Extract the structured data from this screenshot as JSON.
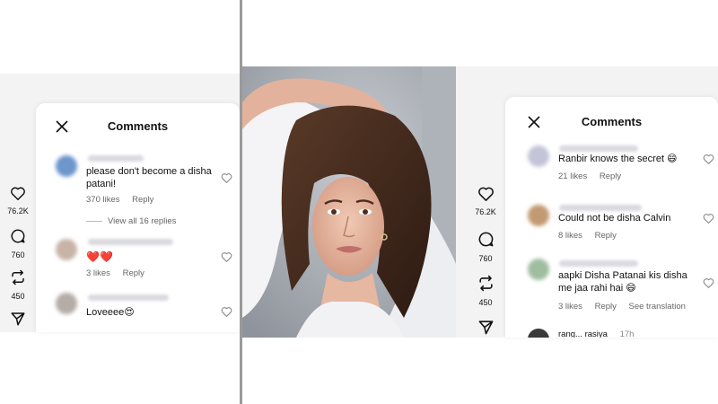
{
  "left": {
    "title": "Comments",
    "rail": {
      "likes": "76.2K",
      "comments": "760",
      "reposts": "450"
    },
    "comments": [
      {
        "text": "please don't become a disha patani!",
        "likes": "370 likes",
        "reply": "Reply",
        "view_replies": "View all 16 replies"
      },
      {
        "text": "❤️❤️",
        "likes": "3 likes",
        "reply": "Reply"
      },
      {
        "text": "Loveeee😍"
      }
    ]
  },
  "right": {
    "title": "Comments",
    "rail": {
      "likes": "76.2K",
      "comments": "760",
      "reposts": "450"
    },
    "comments": [
      {
        "text": "Ranbir knows the secret 😄",
        "likes": "21 likes",
        "reply": "Reply"
      },
      {
        "text": "Could not be disha Calvin",
        "likes": "8 likes",
        "reply": "Reply"
      },
      {
        "text": "aapki Disha Patanai kis disha me jaa rahi hai 😄",
        "likes": "3 likes",
        "reply": "Reply",
        "translate": "See translation"
      },
      {
        "user": "rang... rasiya",
        "time": "17h"
      }
    ]
  },
  "colors": {
    "accent": "#e0245e",
    "background": "#f3f3f3",
    "text": "#111111",
    "muted": "#666666"
  }
}
